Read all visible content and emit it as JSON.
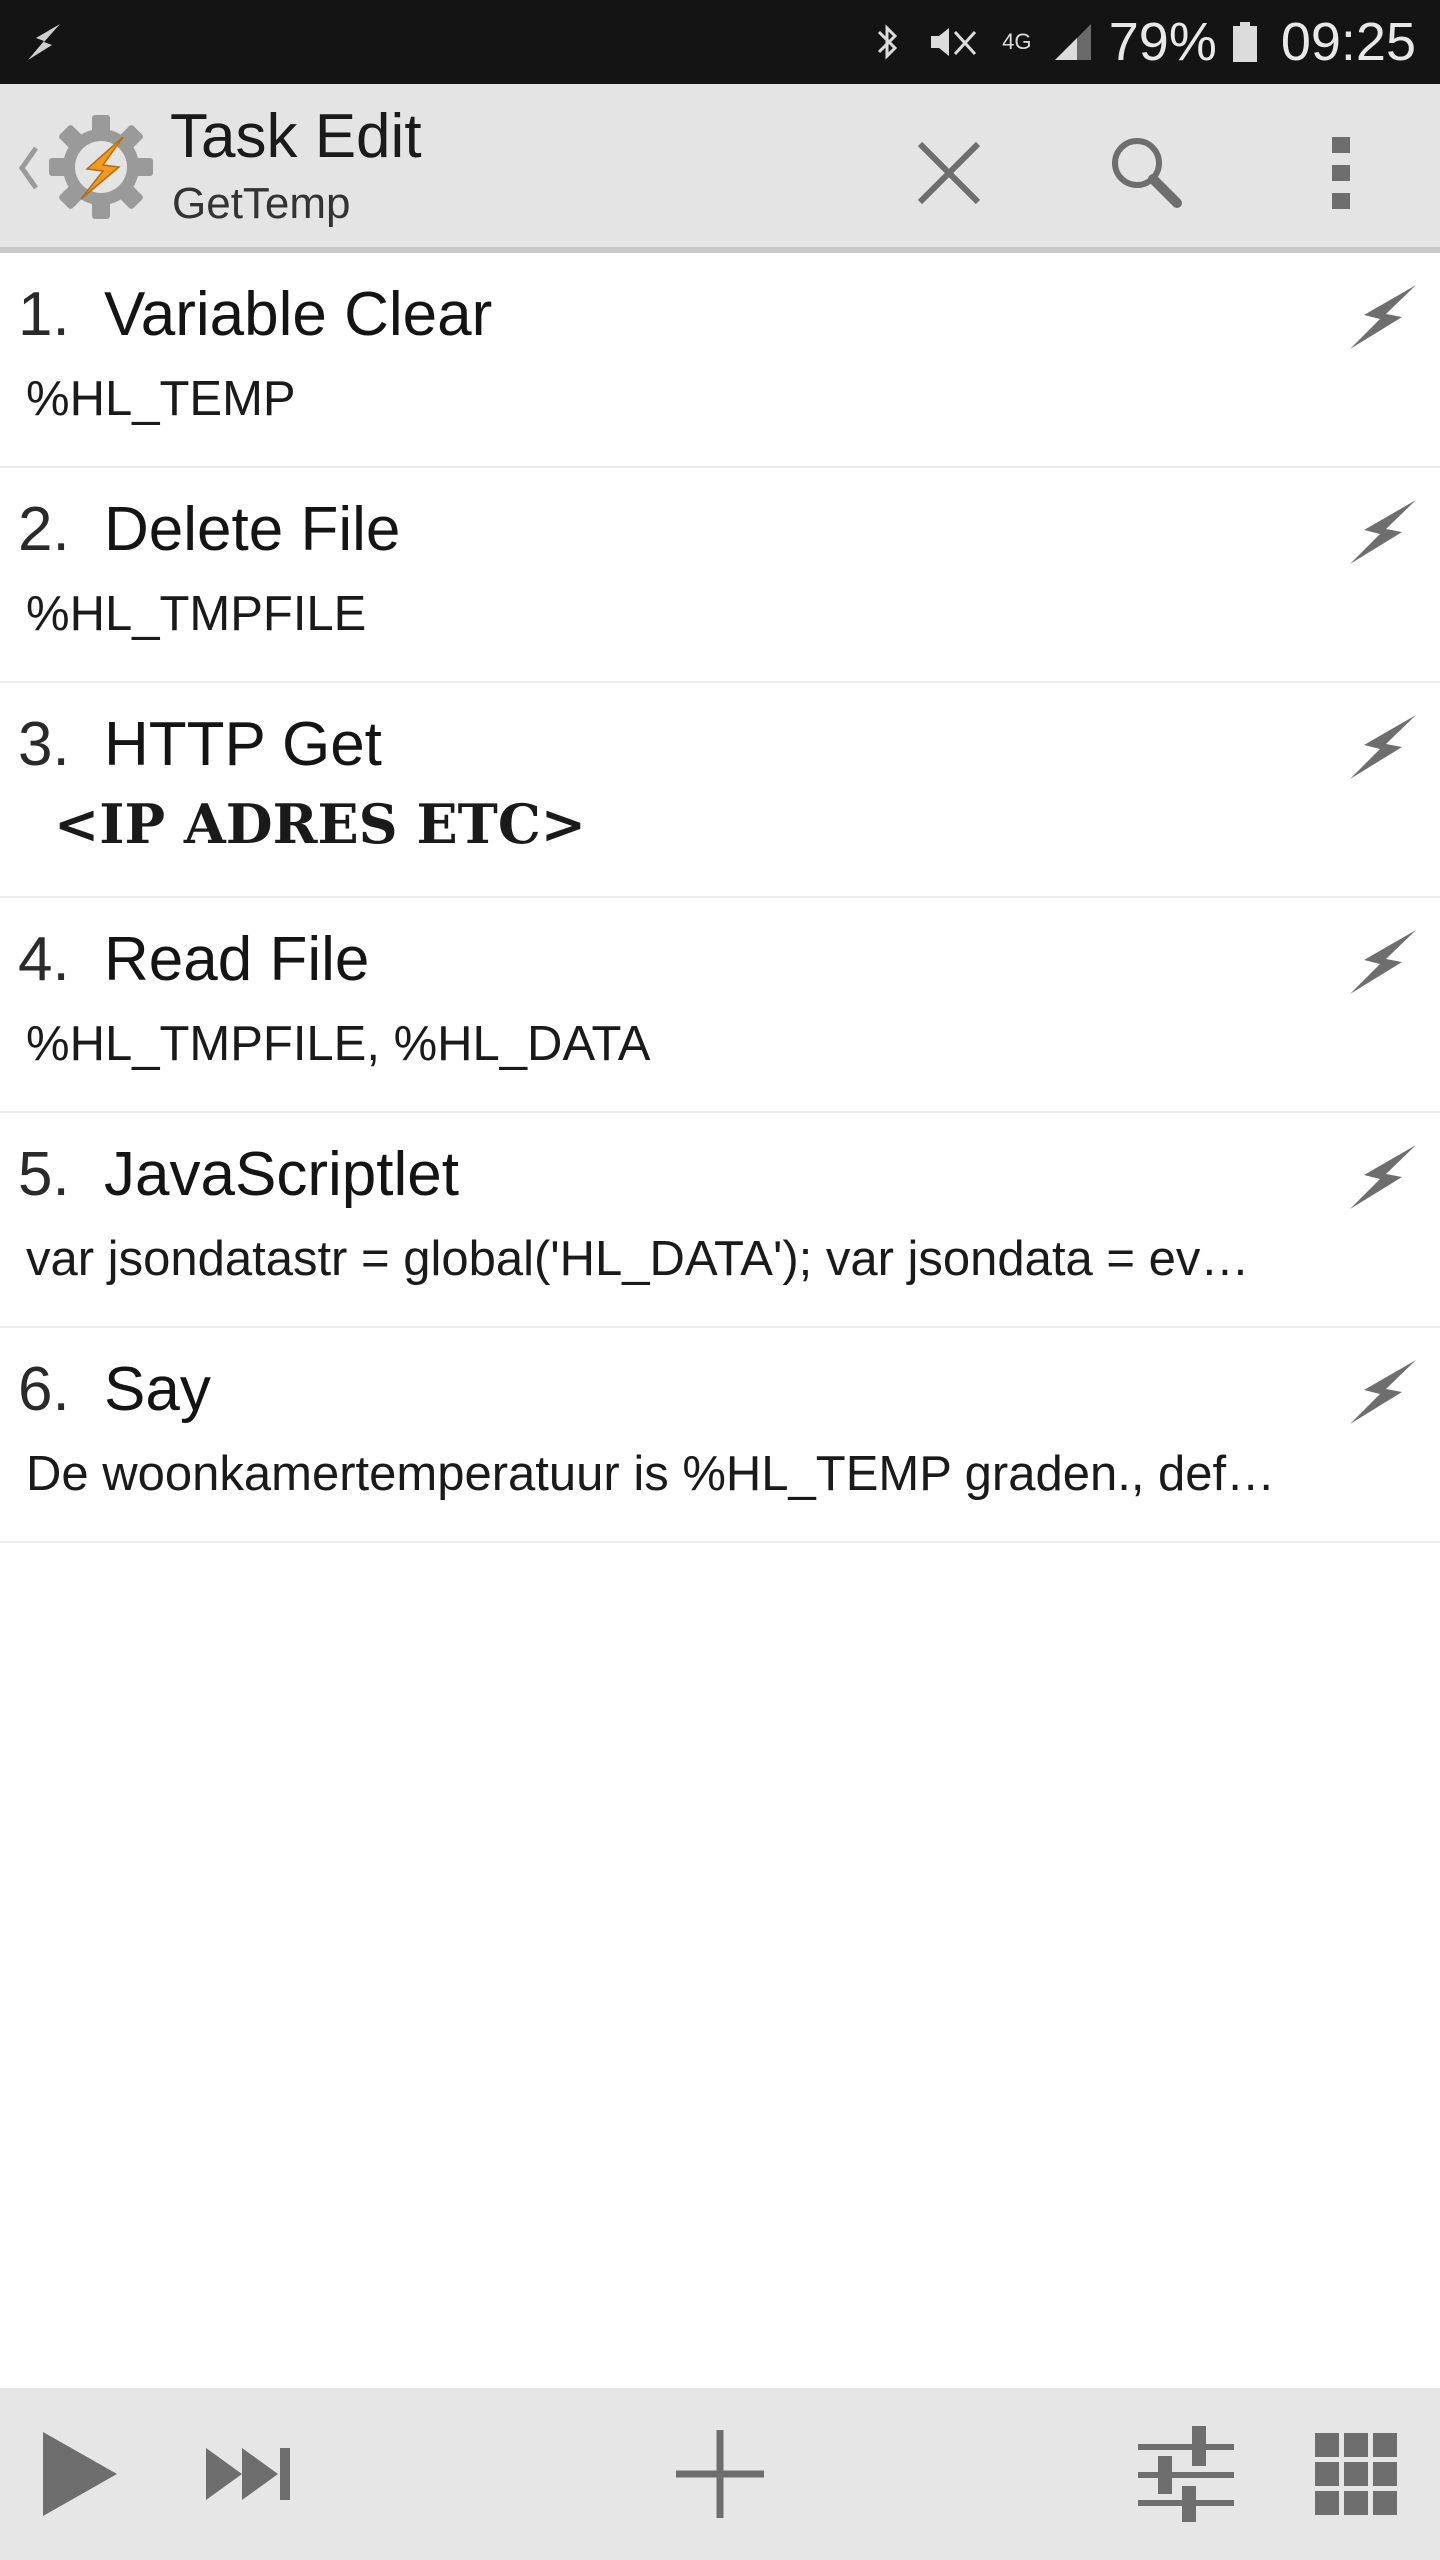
{
  "status_bar": {
    "battery_percent": "79%",
    "time": "09:25",
    "network_label": "4G"
  },
  "action_bar": {
    "title": "Task Edit",
    "subtitle": "GetTemp"
  },
  "actions": [
    {
      "number": "1.",
      "name": "Variable Clear",
      "detail": "%HL_TEMP"
    },
    {
      "number": "2.",
      "name": "Delete File",
      "detail": "%HL_TMPFILE"
    },
    {
      "number": "3.",
      "name": "HTTP Get",
      "detail": "<IP ADRES ETC>"
    },
    {
      "number": "4.",
      "name": "Read File",
      "detail": "%HL_TMPFILE,  %HL_DATA"
    },
    {
      "number": "5.",
      "name": "JavaScriptlet",
      "detail": "var jsondatastr = global('HL_DATA');  var jsondata = ev…"
    },
    {
      "number": "6.",
      "name": "Say",
      "detail": "De woonkamertemperatuur is %HL_TEMP graden.,  def…"
    }
  ],
  "colors": {
    "status_bar_bg": "#141414",
    "action_bar_bg": "#e4e4e4",
    "bottom_bar_bg": "#e6e6e6",
    "icon_gray": "#6e6e6e",
    "logo_orange": "#f29a1f"
  },
  "icons": {
    "status_left": "tasker-bolt-icon",
    "bluetooth": "bluetooth-icon",
    "mute": "mute-icon",
    "signal": "signal-icon",
    "battery": "battery-icon",
    "back": "chevron-left-icon",
    "logo": "tasker-gear-bolt-icon",
    "close": "close-icon",
    "search": "search-icon",
    "more": "more-vert-icon",
    "row_bolt": "bolt-icon",
    "play": "play-icon",
    "skip": "skip-next-icon",
    "add": "plus-icon",
    "tune": "sliders-icon",
    "grid": "grid-icon"
  }
}
